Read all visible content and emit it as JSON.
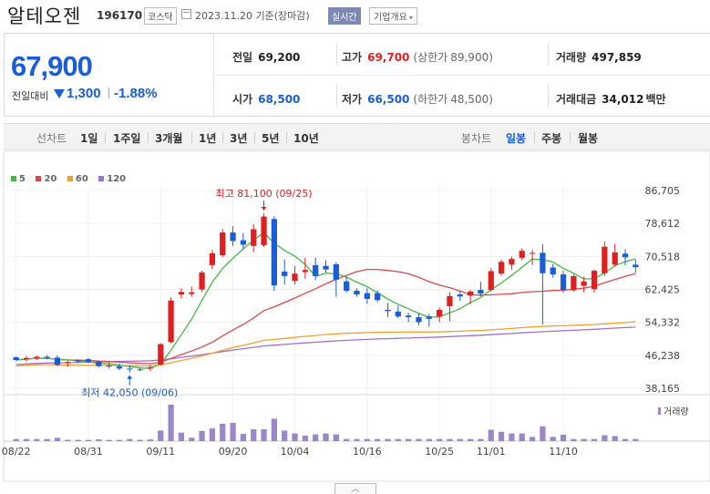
{
  "header": {
    "name": "알테오젠",
    "code": "196170",
    "market": "코스닥",
    "date_text": "2023.11.20 기준(장마감)",
    "realtime_label": "실시간",
    "overview_label": "기업개요"
  },
  "summary": {
    "price": "67,900",
    "change_label": "전일대비",
    "change_value": "1,300",
    "change_pct": "-1.88%",
    "prev_close": {
      "label": "전일",
      "value": "69,200"
    },
    "open": {
      "label": "시가",
      "value": "68,500"
    },
    "high": {
      "label": "고가",
      "value": "69,700",
      "limit_label": "(상한가",
      "limit_value": "89,900)"
    },
    "low": {
      "label": "저가",
      "value": "66,500",
      "limit_label": "(하한가",
      "limit_value": "48,500)"
    },
    "volume": {
      "label": "거래량",
      "value": "497,859"
    },
    "amount": {
      "label": "거래대금",
      "value": "34,012",
      "unit": "백만"
    }
  },
  "toolbar": {
    "line_chart": "선차트",
    "periods": [
      "1일",
      "1주일",
      "3개월",
      "1년",
      "3년",
      "5년",
      "10년"
    ],
    "candle_chart": "봉차트",
    "candle_periods": [
      "일봉",
      "주봉",
      "월봉"
    ],
    "active_candle": "일봉"
  },
  "colors": {
    "up": "#e02020",
    "down": "#1a5dd6",
    "ma5": "#44bb44",
    "ma20": "#e04848",
    "ma60": "#f0a030",
    "ma120": "#a070d0",
    "volume": "#9b86c8"
  },
  "chart_data": {
    "type": "candlestick",
    "title": "",
    "ylim": [
      38165,
      86705
    ],
    "yticks": [
      "86,705",
      "78,612",
      "70,518",
      "62,425",
      "54,332",
      "46,238",
      "38,165"
    ],
    "xtick_labels": [
      {
        "i": 0,
        "label": "08/22"
      },
      {
        "i": 7,
        "label": "08/31"
      },
      {
        "i": 14,
        "label": "09/11"
      },
      {
        "i": 21,
        "label": "09/20"
      },
      {
        "i": 27,
        "label": "10/04"
      },
      {
        "i": 34,
        "label": "10/16"
      },
      {
        "i": 41,
        "label": "10/25"
      },
      {
        "i": 46,
        "label": "11/01"
      },
      {
        "i": 53,
        "label": "11/10"
      }
    ],
    "legend": [
      {
        "name": "5",
        "key": "ma5"
      },
      {
        "name": "20",
        "key": "ma20"
      },
      {
        "name": "60",
        "key": "ma60"
      },
      {
        "name": "120",
        "key": "ma120"
      }
    ],
    "volume_label": "거래량",
    "annotations": {
      "high": {
        "text": "최고 81,100 (09/25)",
        "index": 24,
        "value": 81100
      },
      "low": {
        "text": "최저 42,050 (09/06)",
        "index": 11,
        "value": 42050
      }
    },
    "candles": [
      [
        45800,
        45900,
        44900,
        45100
      ],
      [
        45200,
        46100,
        44800,
        45600
      ],
      [
        45600,
        46200,
        45100,
        45900
      ],
      [
        45900,
        46300,
        45300,
        45600
      ],
      [
        45700,
        46200,
        43600,
        43900
      ],
      [
        44300,
        45000,
        43400,
        44600
      ],
      [
        45100,
        45300,
        44300,
        44700
      ],
      [
        45300,
        45600,
        44300,
        44600
      ],
      [
        44700,
        44900,
        43300,
        43600
      ],
      [
        43800,
        44500,
        43000,
        43500
      ],
      [
        43500,
        44200,
        42600,
        43000
      ],
      [
        43000,
        43700,
        42050,
        42900
      ],
      [
        42800,
        43300,
        42400,
        42600
      ],
      [
        43000,
        43900,
        42400,
        43300
      ],
      [
        44000,
        49200,
        43800,
        49000
      ],
      [
        49500,
        60500,
        49200,
        59700
      ],
      [
        61200,
        62700,
        60200,
        61800
      ],
      [
        61300,
        63100,
        60600,
        61700
      ],
      [
        62400,
        67000,
        61800,
        66600
      ],
      [
        68400,
        72100,
        67400,
        71300
      ],
      [
        70800,
        77200,
        70300,
        76400
      ],
      [
        76400,
        78000,
        73100,
        74300
      ],
      [
        74500,
        76300,
        72300,
        73400
      ],
      [
        73100,
        78400,
        71600,
        77200
      ],
      [
        73300,
        81100,
        72800,
        80300
      ],
      [
        79700,
        80400,
        62000,
        63400
      ],
      [
        66800,
        69800,
        63600,
        65700
      ],
      [
        64500,
        68200,
        63600,
        66300
      ],
      [
        66700,
        70200,
        65100,
        67200
      ],
      [
        68400,
        70200,
        64700,
        65700
      ],
      [
        68200,
        69600,
        66600,
        67300
      ],
      [
        68600,
        69100,
        60600,
        64800
      ],
      [
        64400,
        65600,
        61700,
        62100
      ],
      [
        62100,
        62700,
        60600,
        61200
      ],
      [
        61500,
        62700,
        58900,
        60100
      ],
      [
        61500,
        62200,
        59300,
        59800
      ],
      [
        57400,
        59100,
        55600,
        57100
      ],
      [
        57000,
        58500,
        55400,
        55800
      ],
      [
        56000,
        56700,
        54400,
        55600
      ],
      [
        55600,
        56600,
        53600,
        54400
      ],
      [
        55800,
        56400,
        53300,
        55200
      ],
      [
        55800,
        58000,
        54400,
        57400
      ],
      [
        58300,
        61700,
        54600,
        60800
      ],
      [
        61200,
        62100,
        59600,
        60700
      ],
      [
        60900,
        62300,
        58800,
        61900
      ],
      [
        62300,
        64300,
        60800,
        61400
      ],
      [
        62300,
        67600,
        61900,
        66900
      ],
      [
        66300,
        69800,
        65800,
        69200
      ],
      [
        68500,
        70500,
        67200,
        69900
      ],
      [
        70200,
        72500,
        69600,
        71900
      ],
      [
        71400,
        72100,
        68400,
        71400
      ],
      [
        71400,
        73500,
        53800,
        66400
      ],
      [
        67800,
        68700,
        65300,
        66100
      ],
      [
        66100,
        67000,
        61600,
        62300
      ],
      [
        62200,
        66100,
        61900,
        65700
      ],
      [
        63300,
        65600,
        61700,
        64400
      ],
      [
        62500,
        67300,
        61600,
        67000
      ],
      [
        66400,
        74200,
        65800,
        72900
      ],
      [
        68500,
        73600,
        68000,
        71500
      ],
      [
        71200,
        72300,
        68300,
        70300
      ],
      [
        68500,
        69700,
        66500,
        67900
      ]
    ],
    "volumes": [
      0.5,
      0.5,
      0.5,
      0.5,
      0.8,
      0.3,
      0.3,
      0.3,
      0.4,
      0.3,
      0.3,
      0.5,
      0.3,
      0.4,
      2.5,
      8.6,
      2.0,
      0.8,
      2.4,
      3.0,
      4.1,
      4.3,
      1.7,
      2.8,
      2.8,
      5.3,
      2.5,
      1.8,
      1.3,
      1.6,
      1.8,
      1.6,
      0.5,
      0.5,
      0.5,
      0.5,
      0.5,
      0.5,
      0.5,
      0.5,
      0.5,
      0.5,
      0.5,
      0.5,
      0.5,
      0.5,
      2.7,
      2.2,
      1.8,
      1.8,
      1.0,
      3.5,
      1.0,
      1.5,
      0.5,
      0.5,
      0.5,
      1.4,
      1.2,
      0.5,
      0.5
    ]
  }
}
